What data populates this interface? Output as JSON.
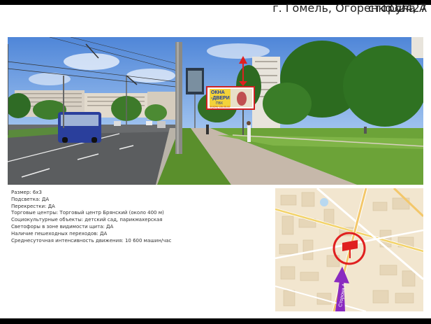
{
  "header": {
    "address": "г. Гомель, Огоренко ул., 7",
    "side": "сторона А",
    "code": "ГО2427"
  },
  "photo": {
    "billboard_line1": "ОКНА",
    "billboard_line2": "-ДВЕРИ",
    "billboard_line3": "ПВХ",
    "billboard_phone": "8 (029) 135-05-00"
  },
  "info": {
    "lines": [
      "Размер: 6х3",
      "Подсветка: ДА",
      "Перекрестки: ДА",
      "Торговые центры: Торговый центр Брянский (около 400 м)",
      "Социокультурные объекты: детский сад, парикмахерская",
      "Светофоры в зоне видимости щита: ДА",
      "Наличие пешеходных переходов: ДА",
      "Среднесуточная интенсивность движения: 10 600 машин/час"
    ]
  },
  "map": {
    "side_label": "Сторона А"
  }
}
